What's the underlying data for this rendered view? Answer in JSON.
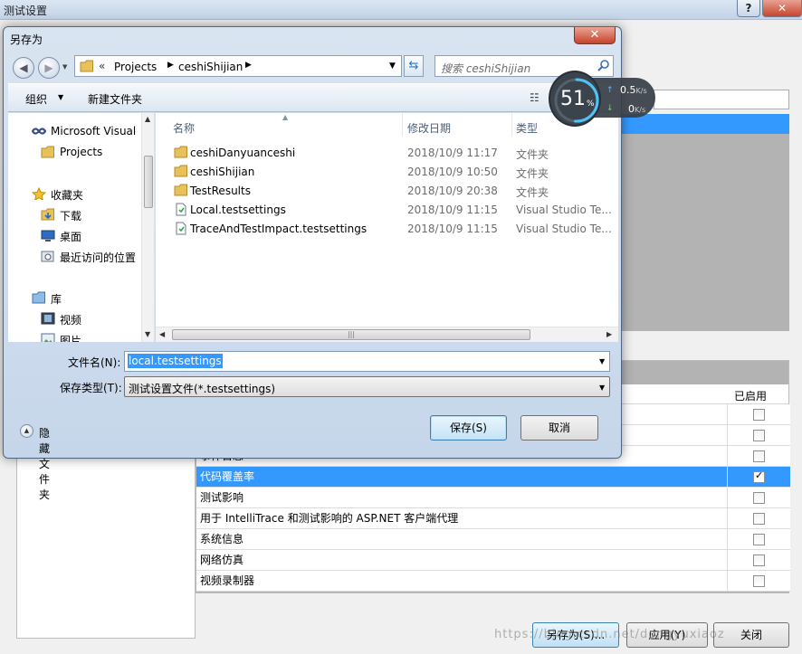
{
  "background_window": {
    "title": "测试设置",
    "help_label": "?",
    "close_label": "✕",
    "grid": {
      "enabled_header": "已启用",
      "rows": [
        {
          "name": "",
          "checked": false,
          "selected": false
        },
        {
          "name": "",
          "checked": false,
          "selected": false
        },
        {
          "name": "事件日志",
          "checked": false,
          "selected": false
        },
        {
          "name": "代码覆盖率",
          "checked": true,
          "selected": true
        },
        {
          "name": "测试影响",
          "checked": false,
          "selected": false
        },
        {
          "name": "用于 IntelliTrace 和测试影响的 ASP.NET 客户端代理",
          "checked": false,
          "selected": false
        },
        {
          "name": "系统信息",
          "checked": false,
          "selected": false
        },
        {
          "name": "网络仿真",
          "checked": false,
          "selected": false
        },
        {
          "name": "视频录制器",
          "checked": false,
          "selected": false
        }
      ]
    },
    "buttons": {
      "save_as": "另存为(S)...",
      "apply": "应用(Y)",
      "close": "关闭"
    },
    "watermark": "https://blog.csdn.net/dongyuxiaoz"
  },
  "dialog": {
    "title": "另存为",
    "close_label": "✕",
    "address": {
      "prefix": "«",
      "crumbs": [
        "Projects",
        "ceshiShijian"
      ]
    },
    "search_placeholder": "搜索 ceshiShijian",
    "toolbar": {
      "organize": "组织",
      "new_folder": "新建文件夹"
    },
    "nav_items": [
      {
        "label": "Microsoft Visual",
        "icon": "vs-icon"
      },
      {
        "label": "Projects",
        "icon": "folder-icon"
      },
      {
        "label": "收藏夹",
        "icon": "star-icon"
      },
      {
        "label": "下载",
        "icon": "download-icon"
      },
      {
        "label": "桌面",
        "icon": "desktop-icon"
      },
      {
        "label": "最近访问的位置",
        "icon": "recent-icon"
      },
      {
        "label": "库",
        "icon": "library-icon"
      },
      {
        "label": "视频",
        "icon": "video-icon"
      },
      {
        "label": "图片",
        "icon": "picture-icon"
      }
    ],
    "columns": {
      "name": "名称",
      "date": "修改日期",
      "type": "类型"
    },
    "files": [
      {
        "name": "ceshiDanyuanceshi",
        "date": "2018/10/9 11:17",
        "type": "文件夹",
        "icon": "folder-icon"
      },
      {
        "name": "ceshiShijian",
        "date": "2018/10/9 10:50",
        "type": "文件夹",
        "icon": "folder-icon"
      },
      {
        "name": "TestResults",
        "date": "2018/10/9 20:38",
        "type": "文件夹",
        "icon": "folder-icon"
      },
      {
        "name": "Local.testsettings",
        "date": "2018/10/9 11:15",
        "type": "Visual Studio Te...",
        "icon": "testsettings-file-icon"
      },
      {
        "name": "TraceAndTestImpact.testsettings",
        "date": "2018/10/9 11:15",
        "type": "Visual Studio Te...",
        "icon": "testsettings-file-icon"
      }
    ],
    "filename_label": "文件名(N):",
    "filename_value": "local.testsettings",
    "filetype_label": "保存类型(T):",
    "filetype_value": "测试设置文件(*.testsettings)",
    "hide_folders": "隐藏文件夹",
    "save_button": "保存(S)",
    "cancel_button": "取消"
  },
  "network_widget": {
    "percent": "51",
    "percent_sign": "%",
    "upload": "0.5",
    "upload_unit": "K/s",
    "download": "0",
    "download_unit": "K/s",
    "accent": "#4fc3f7"
  }
}
